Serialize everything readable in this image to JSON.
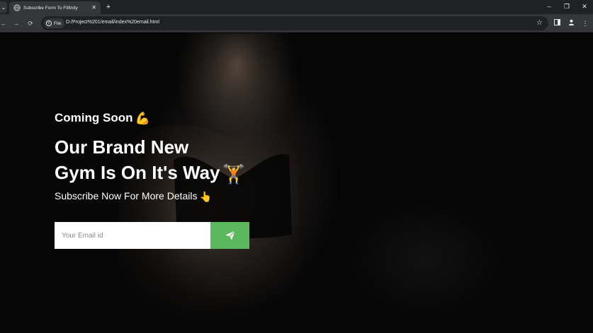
{
  "browser": {
    "tab_title": "Subscribe Form To Fitfinity",
    "tab_close": "✕",
    "new_tab": "+",
    "chip_label": "File",
    "url": "D:/Project%201/email/index%20email.html",
    "window_controls": {
      "minimize": "–",
      "restore": "❐",
      "close": "✕"
    },
    "nav": {
      "back": "←",
      "forward": "→",
      "reload": "⟳"
    },
    "star": "☆",
    "menu": "⋮"
  },
  "page": {
    "coming_soon": "Coming Soon",
    "coming_soon_emoji": "💪",
    "headline_line1": "Our Brand New",
    "headline_line2": "Gym Is On It's Way",
    "headline_emoji": "🏋️",
    "subtitle": "Subscribe Now For More Details",
    "subtitle_emoji": "👆",
    "email_placeholder": "Your Email id",
    "email_value": ""
  },
  "colors": {
    "accent_green": "#5cb85c",
    "chrome_dark": "#202124",
    "chrome_mid": "#35363a"
  },
  "icons": {
    "tab_favicon": "globe-icon",
    "send": "paper-plane-icon"
  }
}
